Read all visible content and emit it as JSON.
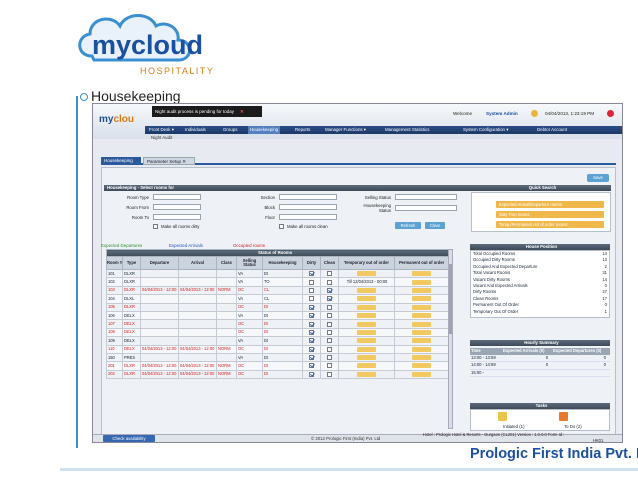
{
  "slide": {
    "logo_main": "mycloud",
    "logo_sub": "HOSPITALITY",
    "title": "Housekeeping",
    "footer_company": "Prologic First India Pvt. Ltd",
    "colors": {
      "brand_blue": "#1b4fa0",
      "brand_orange": "#e07a10",
      "accent_line": "#3a8fd0"
    }
  },
  "app": {
    "logo": {
      "part1": "my",
      "part2": "clou"
    },
    "notice": "Night audit process is pending for today",
    "welcome": "Welcome",
    "user": "System Admin",
    "datetime": "04/04/2013, 1:23:19 PM",
    "menu": [
      "Front Desk ▾",
      "Individuals",
      "Groups",
      "Housekeeping",
      "Reports",
      "Manager Functions ▾",
      "Management Statistics",
      "System Configuration ▾",
      "Debtor Account"
    ],
    "active_menu_index": 3,
    "sub_nav": "Night Audit",
    "tabs": [
      "Housekeeping",
      "Parameter Setup"
    ],
    "save_label": "Save",
    "select_header": "Housekeeping - Select rooms for",
    "filters": {
      "room_type": "Room Type",
      "room_from": "Room From",
      "room_to": "Room To",
      "section": "Section",
      "block": "Block",
      "floor": "Floor",
      "selling_status": "Selling Status",
      "hk_status_1": "Housekeeping",
      "hk_status_2": "Status",
      "make_dirty": "Make all rooms dirty",
      "make_clean": "Make all rooms clean",
      "refresh": "Refresh",
      "clear": "Clear"
    },
    "quick_search": {
      "header": "Quick Search",
      "buttons": [
        "Expected Arrival/Departure rooms",
        "Stay Toru rooms",
        "Temp./Permanent out of order rooms"
      ]
    },
    "legend": {
      "departures": "Expected Departures",
      "arrivals": "Expected Arrivals",
      "occupied": "Occupied rooms",
      "departures_color": "#2f8f2f",
      "arrivals_color": "#2a4fc0",
      "occupied_color": "#d02020"
    },
    "rooms_header": "Status of Rooms",
    "columns": [
      "Room #",
      "Type",
      "Departure",
      "Arrival",
      "Class",
      "Selling Status",
      "Housekeeping",
      "Dirty",
      "Clean",
      "Temporary out of order",
      "Permanent out of order"
    ],
    "rows": [
      {
        "room": "101",
        "type": "DLXR",
        "dep": "",
        "arr": "",
        "cls": "",
        "sell": "VA",
        "hk": "DI",
        "dirty": true,
        "clean": false,
        "red": false
      },
      {
        "room": "102",
        "type": "DLXR",
        "dep": "",
        "arr": "",
        "cls": "",
        "sell": "VA",
        "hk": "TO",
        "dirty": false,
        "clean": false,
        "red": false,
        "temp_note": "Till 12/04/2013 - 00:00"
      },
      {
        "room": "103",
        "type": "DLXR",
        "dep": "04/04/2013 - 12:00",
        "arr": "04/04/2013 - 12:00",
        "cls": "NORM",
        "sell": "OC",
        "hk": "CL",
        "dirty": false,
        "clean": true,
        "red": true
      },
      {
        "room": "104",
        "type": "DLXL",
        "dep": "",
        "arr": "",
        "cls": "",
        "sell": "VA",
        "hk": "CL",
        "dirty": false,
        "clean": true,
        "red": false
      },
      {
        "room": "105",
        "type": "DLXR",
        "dep": "",
        "arr": "",
        "cls": "",
        "sell": "OC",
        "hk": "DI",
        "dirty": true,
        "clean": false,
        "red": true
      },
      {
        "room": "106",
        "type": "DELX",
        "dep": "",
        "arr": "",
        "cls": "",
        "sell": "VA",
        "hk": "DI",
        "dirty": true,
        "clean": false,
        "red": false
      },
      {
        "room": "107",
        "type": "DELX",
        "dep": "",
        "arr": "",
        "cls": "",
        "sell": "OC",
        "hk": "DI",
        "dirty": true,
        "clean": false,
        "red": true
      },
      {
        "room": "108",
        "type": "DELX",
        "dep": "",
        "arr": "",
        "cls": "",
        "sell": "OC",
        "hk": "DI",
        "dirty": true,
        "clean": false,
        "red": true
      },
      {
        "room": "109",
        "type": "DELX",
        "dep": "",
        "arr": "",
        "cls": "",
        "sell": "VA",
        "hk": "DI",
        "dirty": true,
        "clean": false,
        "red": false
      },
      {
        "room": "110",
        "type": "DELX",
        "dep": "04/04/2013 - 12:00",
        "arr": "04/04/2013 - 12:00",
        "cls": "NORM",
        "sell": "OC",
        "hk": "DI",
        "dirty": true,
        "clean": false,
        "red": true
      },
      {
        "room": "150",
        "type": "PRES",
        "dep": "",
        "arr": "",
        "cls": "",
        "sell": "VA",
        "hk": "DI",
        "dirty": true,
        "clean": false,
        "red": false
      },
      {
        "room": "201",
        "type": "DLXR",
        "dep": "04/04/2013 - 12:00",
        "arr": "04/04/2013 - 12:00",
        "cls": "NORM",
        "sell": "OC",
        "hk": "DI",
        "dirty": true,
        "clean": false,
        "red": true
      },
      {
        "room": "202",
        "type": "DLXR",
        "dep": "04/04/2013 - 12:00",
        "arr": "04/04/2013 - 12:00",
        "cls": "NORM",
        "sell": "OC",
        "hk": "DI",
        "dirty": true,
        "clean": false,
        "red": true
      }
    ],
    "house_position": {
      "header": "House Position",
      "items": [
        {
          "label": "Total Occupied Rooms",
          "value": "14"
        },
        {
          "label": "Occupied Dirty Rooms",
          "value": "13"
        },
        {
          "label": "Occupied And Expected Departure",
          "value": "2"
        },
        {
          "label": "Total Vacant Rooms",
          "value": "31"
        },
        {
          "label": "Vacant Dirty Rooms",
          "value": "14"
        },
        {
          "label": "Vacant And Expected Arrivals",
          "value": "0"
        },
        {
          "label": "Dirty Rooms",
          "value": "27"
        },
        {
          "label": "Clean Rooms",
          "value": "17"
        },
        {
          "label": "Permanent Out Of Order",
          "value": "0"
        },
        {
          "label": "Temporary Out Of Order",
          "value": "1"
        }
      ]
    },
    "hourly": {
      "header": "Hourly Summary",
      "columns": [
        "Time",
        "Expected Arrivals (0)",
        "Expected Departures (0)"
      ],
      "rows": [
        {
          "time": "13:00 - 13:59",
          "arr": "0",
          "dep": "0"
        },
        {
          "time": "14:00 - 14:59",
          "arr": "0",
          "dep": "0"
        },
        {
          "time": "15:00 -",
          "arr": "",
          "dep": ""
        }
      ]
    },
    "tasks": {
      "header": "Tasks",
      "initiated": "Initiated (1)",
      "todo": "To Do (2)"
    },
    "check_availability": "Check availability",
    "copyright": "© 2012 Prologic First (India) Pvt. Ltd",
    "hotel_info": "Hotel : Prologic Hotel & Resorts - Gurgaon (CL201)   Version : 1.0.0.0   Form Id :",
    "form_id": "HK01"
  }
}
